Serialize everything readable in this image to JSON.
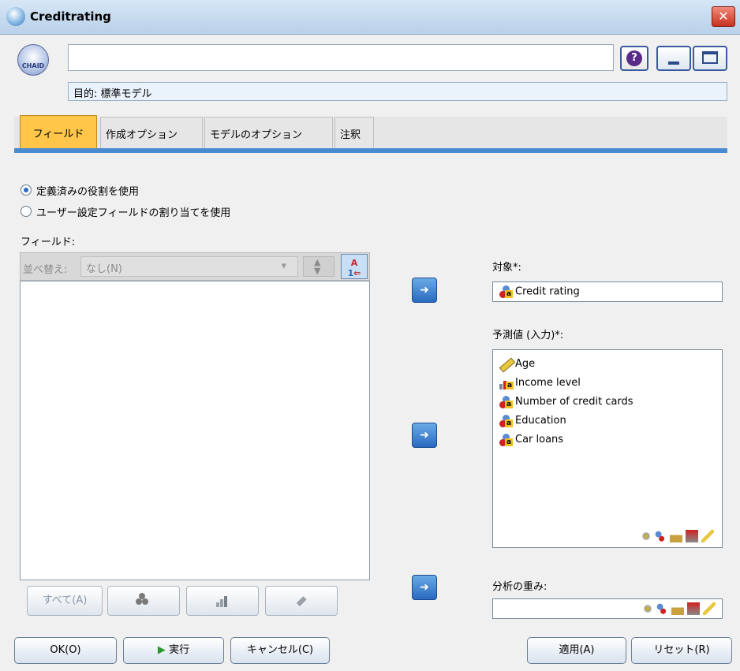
{
  "window": {
    "title": "Creditrating",
    "close_glyph": "✕"
  },
  "header": {
    "node_name": "",
    "purpose": "目的: 標準モデル",
    "chaid_badge": "CHAID",
    "help_glyph": "?"
  },
  "tabs": [
    {
      "label": "フィールド",
      "active": true
    },
    {
      "label": "作成オプション",
      "active": false
    },
    {
      "label": "モデルのオプション",
      "active": false
    },
    {
      "label": "注釈",
      "active": false
    }
  ],
  "roles": {
    "option_predefined": "定義済みの役割を使用",
    "option_custom": "ユーザー設定フィールドの割り当てを使用",
    "selected": "predefined"
  },
  "fields_panel": {
    "label": "フィールド:",
    "sort_label": "並べ替え:",
    "sort_value": "なし(N)",
    "items": [],
    "btn_all": "すべて(A)"
  },
  "target": {
    "label": "対象*:",
    "value": "Credit rating"
  },
  "predictors": {
    "label": "予測値 (入力)*:",
    "items": [
      {
        "label": "Age",
        "icon": "continuous-ruler-icon"
      },
      {
        "label": "Income level",
        "icon": "ordinal-icon"
      },
      {
        "label": "Number of credit cards",
        "icon": "nominal-icon"
      },
      {
        "label": "Education",
        "icon": "nominal-icon"
      },
      {
        "label": "Car loans",
        "icon": "nominal-icon"
      }
    ]
  },
  "weight": {
    "label": "分析の重み:",
    "value": ""
  },
  "buttons": {
    "ok": "OK(O)",
    "run": "実行",
    "cancel": "キャンセル(C)",
    "apply": "適用(A)",
    "reset": "リセット(R)"
  },
  "colors": {
    "tab_active": "#ffc64a",
    "accent": "#4a8ad0",
    "arrow_button": "#2a6ac0"
  }
}
